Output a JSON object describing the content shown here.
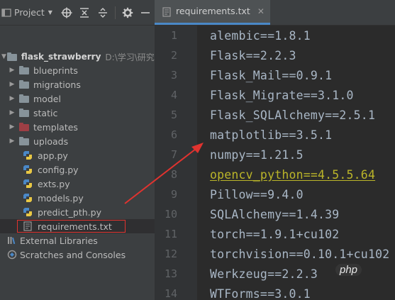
{
  "project_toolbar": {
    "title": "Project",
    "icons": [
      "target-icon",
      "collapse-all-icon",
      "expand-icon",
      "gear-icon",
      "hide-icon"
    ]
  },
  "tree": {
    "root": {
      "name": "flask_strawberry",
      "path": "D:\\学习\\研究生"
    },
    "folders": [
      {
        "name": "blueprints"
      },
      {
        "name": "migrations"
      },
      {
        "name": "model"
      },
      {
        "name": "static"
      },
      {
        "name": "templates"
      },
      {
        "name": "uploads"
      }
    ],
    "files": [
      {
        "name": "app.py"
      },
      {
        "name": "config.py"
      },
      {
        "name": "exts.py"
      },
      {
        "name": "models.py"
      },
      {
        "name": "predict_pth.py"
      },
      {
        "name": "requirements.txt"
      }
    ],
    "external_libraries": "External Libraries",
    "scratches": "Scratches and Consoles"
  },
  "editor": {
    "tab_label": "requirements.txt",
    "lines": [
      {
        "num": "1",
        "text": "alembic==1.8.1"
      },
      {
        "num": "2",
        "text": "Flask==2.2.3"
      },
      {
        "num": "3",
        "text": "Flask_Mail==0.9.1"
      },
      {
        "num": "4",
        "text": "Flask_Migrate==3.1.0"
      },
      {
        "num": "5",
        "text": "Flask_SQLAlchemy==2.5.1"
      },
      {
        "num": "6",
        "text": "matplotlib==3.5.1"
      },
      {
        "num": "7",
        "text": "numpy==1.21.5"
      },
      {
        "num": "8",
        "text": "opencv_python==4.5.5.64"
      },
      {
        "num": "9",
        "text": "Pillow==9.4.0"
      },
      {
        "num": "10",
        "text": "SQLAlchemy==1.4.39"
      },
      {
        "num": "11",
        "text": "torch==1.9.1+cu102"
      },
      {
        "num": "12",
        "text": "torchvision==0.10.1+cu102"
      },
      {
        "num": "13",
        "text": "Werkzeug==2.2.3"
      },
      {
        "num": "14",
        "text": "WTForms==3.0.1"
      }
    ]
  },
  "watermark": "php",
  "colors": {
    "annotation_red": "#e0332f",
    "warning_yellow": "#bbb529",
    "code_text": "#a9b7c6"
  }
}
